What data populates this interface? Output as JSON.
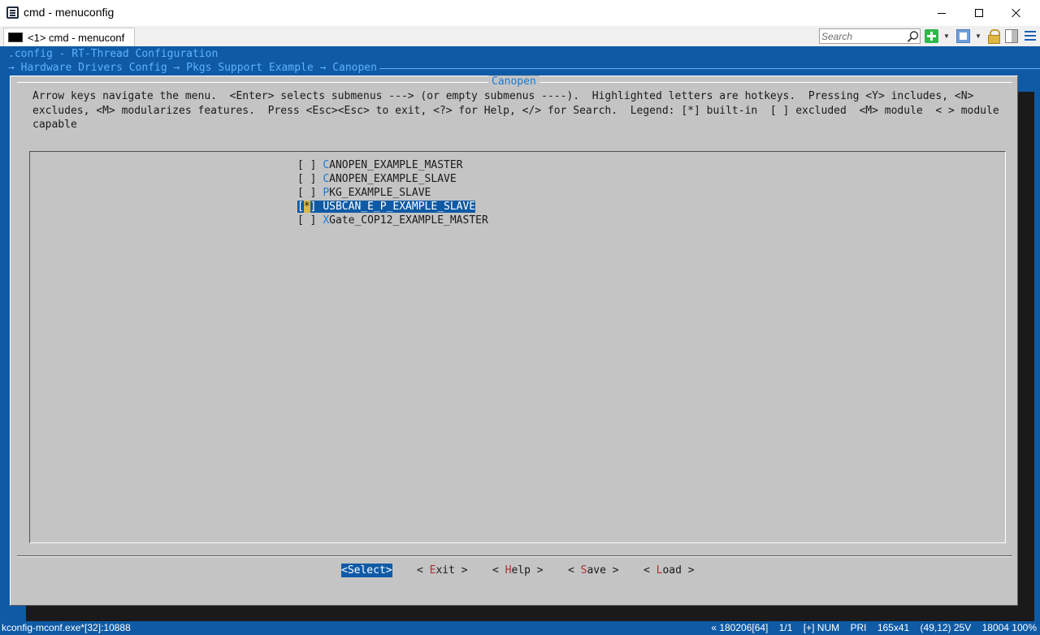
{
  "window": {
    "title": "cmd - menuconfig"
  },
  "tab": {
    "label": "<1> cmd - menuconf"
  },
  "toolbar": {
    "search_placeholder": "Search"
  },
  "console": {
    "line1": ".config - RT-Thread Configuration",
    "line2": "→ Hardware Drivers Config → Pkgs Support Example → Canopen "
  },
  "dialog": {
    "title": "Canopen",
    "help_text": "Arrow keys navigate the menu.  <Enter> selects submenus ---> (or empty submenus ----).  Highlighted letters are hotkeys.  Pressing <Y> includes, <N>\nexcludes, <M> modularizes features.  Press <Esc><Esc> to exit, <?> for Help, </> for Search.  Legend: [*] built-in  [ ] excluded  <M> module  < > module\ncapable",
    "items": [
      {
        "check": "[ ]",
        "hotkey": "C",
        "rest": "ANOPEN_EXAMPLE_MASTER",
        "selected": false
      },
      {
        "check": "[ ]",
        "hotkey": "C",
        "rest": "ANOPEN_EXAMPLE_SLAVE",
        "selected": false
      },
      {
        "check": "[ ]",
        "hotkey": "P",
        "rest": "KG_EXAMPLE_SLAVE",
        "selected": false
      },
      {
        "check_open": "[",
        "check_mark": "*",
        "check_close": "]",
        "label": "USBCAN_E_P_EXAMPLE_SLAVE",
        "selected": true
      },
      {
        "check": "[ ]",
        "hotkey": "X",
        "rest": "Gate_COP12_EXAMPLE_MASTER",
        "selected": false
      }
    ],
    "buttons": {
      "select": "<Select>",
      "exit_open": "< ",
      "exit_hotkey": "E",
      "exit_rest": "xit >",
      "help_open": "< ",
      "help_hotkey": "H",
      "help_rest": "elp >",
      "save_open": "< ",
      "save_hotkey": "S",
      "save_rest": "ave >",
      "load_open": "< ",
      "load_hotkey": "L",
      "load_rest": "oad >"
    }
  },
  "statusbar": {
    "left": "kconfig-mconf.exe*[32]:10888",
    "info": "« 180206[64]",
    "page": "1/1",
    "mode": "[+] NUM",
    "pri": "PRI",
    "size": "165x41",
    "cursor": "(49,12) 25V",
    "pid_zoom": "18004 100%"
  },
  "colors": {
    "console_bg": "#0f5aa5",
    "dialog_bg": "#c4c4c4",
    "hotkey": "#1a7bd6",
    "button_hotkey": "#b03030"
  }
}
